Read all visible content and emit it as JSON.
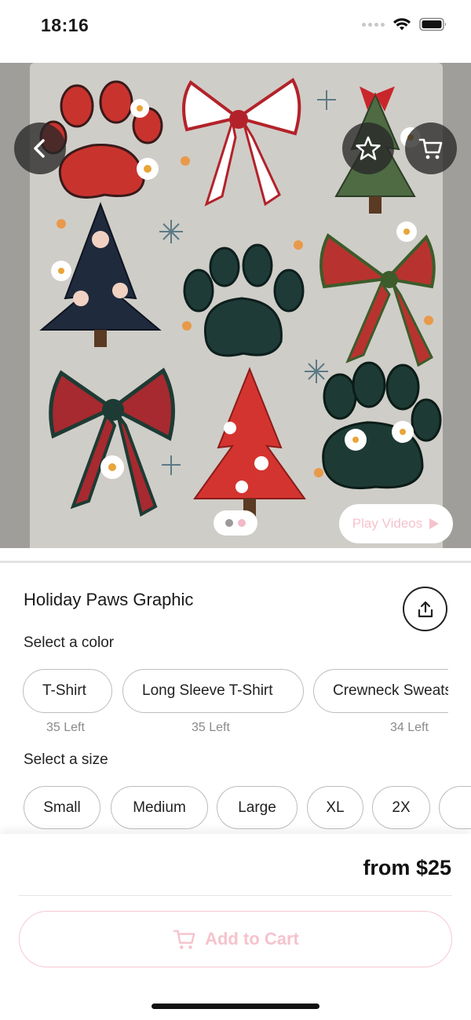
{
  "status_bar": {
    "time": "18:16",
    "icons": [
      "cellular-dots-icon",
      "wifi-icon",
      "battery-icon"
    ]
  },
  "hero": {
    "image_description": "holiday-paws-graphic-image",
    "pager_count": 2,
    "pager_active_index": 1,
    "play_videos_label": "Play Videos",
    "icons": {
      "back": "chevron-left-icon",
      "favorite": "star-icon",
      "cart": "cart-icon",
      "play": "play-triangle-icon"
    }
  },
  "product": {
    "title": "Holiday Paws Graphic",
    "share_icon": "share-icon"
  },
  "color_select": {
    "label": "Select a color",
    "options": [
      {
        "label": "T-Shirt",
        "stock": "35 Left"
      },
      {
        "label": "Long Sleeve T-Shirt",
        "stock": "35 Left"
      },
      {
        "label": "Crewneck Sweatshirt",
        "stock": "34 Left"
      }
    ]
  },
  "size_select": {
    "label": "Select a size",
    "options": [
      "Small",
      "Medium",
      "Large",
      "XL",
      "2X"
    ]
  },
  "purchase": {
    "price": "from $25",
    "add_to_cart_label": "Add to Cart",
    "accent_color": "#f5c3cd"
  }
}
